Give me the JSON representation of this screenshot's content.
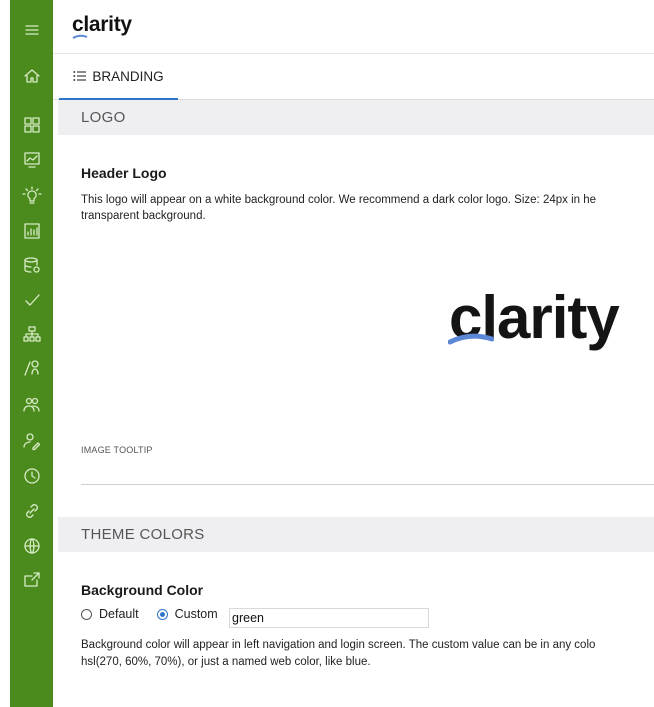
{
  "app": {
    "brand": "clarity"
  },
  "sidebar": {
    "items": [
      {
        "icon": "menu-icon"
      },
      {
        "icon": "home-icon"
      },
      {
        "icon": "dashboard-icon"
      },
      {
        "icon": "chart-icon"
      },
      {
        "icon": "lightbulb-icon"
      },
      {
        "icon": "bar-chart-icon"
      },
      {
        "icon": "database-icon"
      },
      {
        "icon": "check-icon"
      },
      {
        "icon": "hierarchy-icon"
      },
      {
        "icon": "user-search-icon"
      },
      {
        "icon": "users-icon"
      },
      {
        "icon": "user-edit-icon"
      },
      {
        "icon": "clock-icon"
      },
      {
        "icon": "link-icon"
      },
      {
        "icon": "globe-icon"
      },
      {
        "icon": "export-icon"
      }
    ]
  },
  "tabs": [
    {
      "label": "BRANDING",
      "icon": "list-icon"
    }
  ],
  "logo_section": {
    "header": "LOGO",
    "title": "Header Logo",
    "description_line1": "This logo will appear on a white background color. We recommend a dark color logo. Size: 24px in he",
    "description_line2": "transparent background.",
    "preview_text": "clarity",
    "tooltip_label": "IMAGE TOOLTIP",
    "tooltip_value": ""
  },
  "theme_section": {
    "header": "THEME COLORS",
    "title": "Background Color",
    "options": {
      "default_label": "Default",
      "custom_label": "Custom",
      "selected": "Custom"
    },
    "custom_value": "green",
    "description_line1": "Background color will appear in left navigation and login screen. The custom value can be in any colo",
    "description_line2": "hsl(270, 60%, 70%), or just a named web color, like blue."
  },
  "colors": {
    "sidebar": "#4b8a1c",
    "accent": "#2e74c9",
    "section_bg": "#efeff2"
  }
}
